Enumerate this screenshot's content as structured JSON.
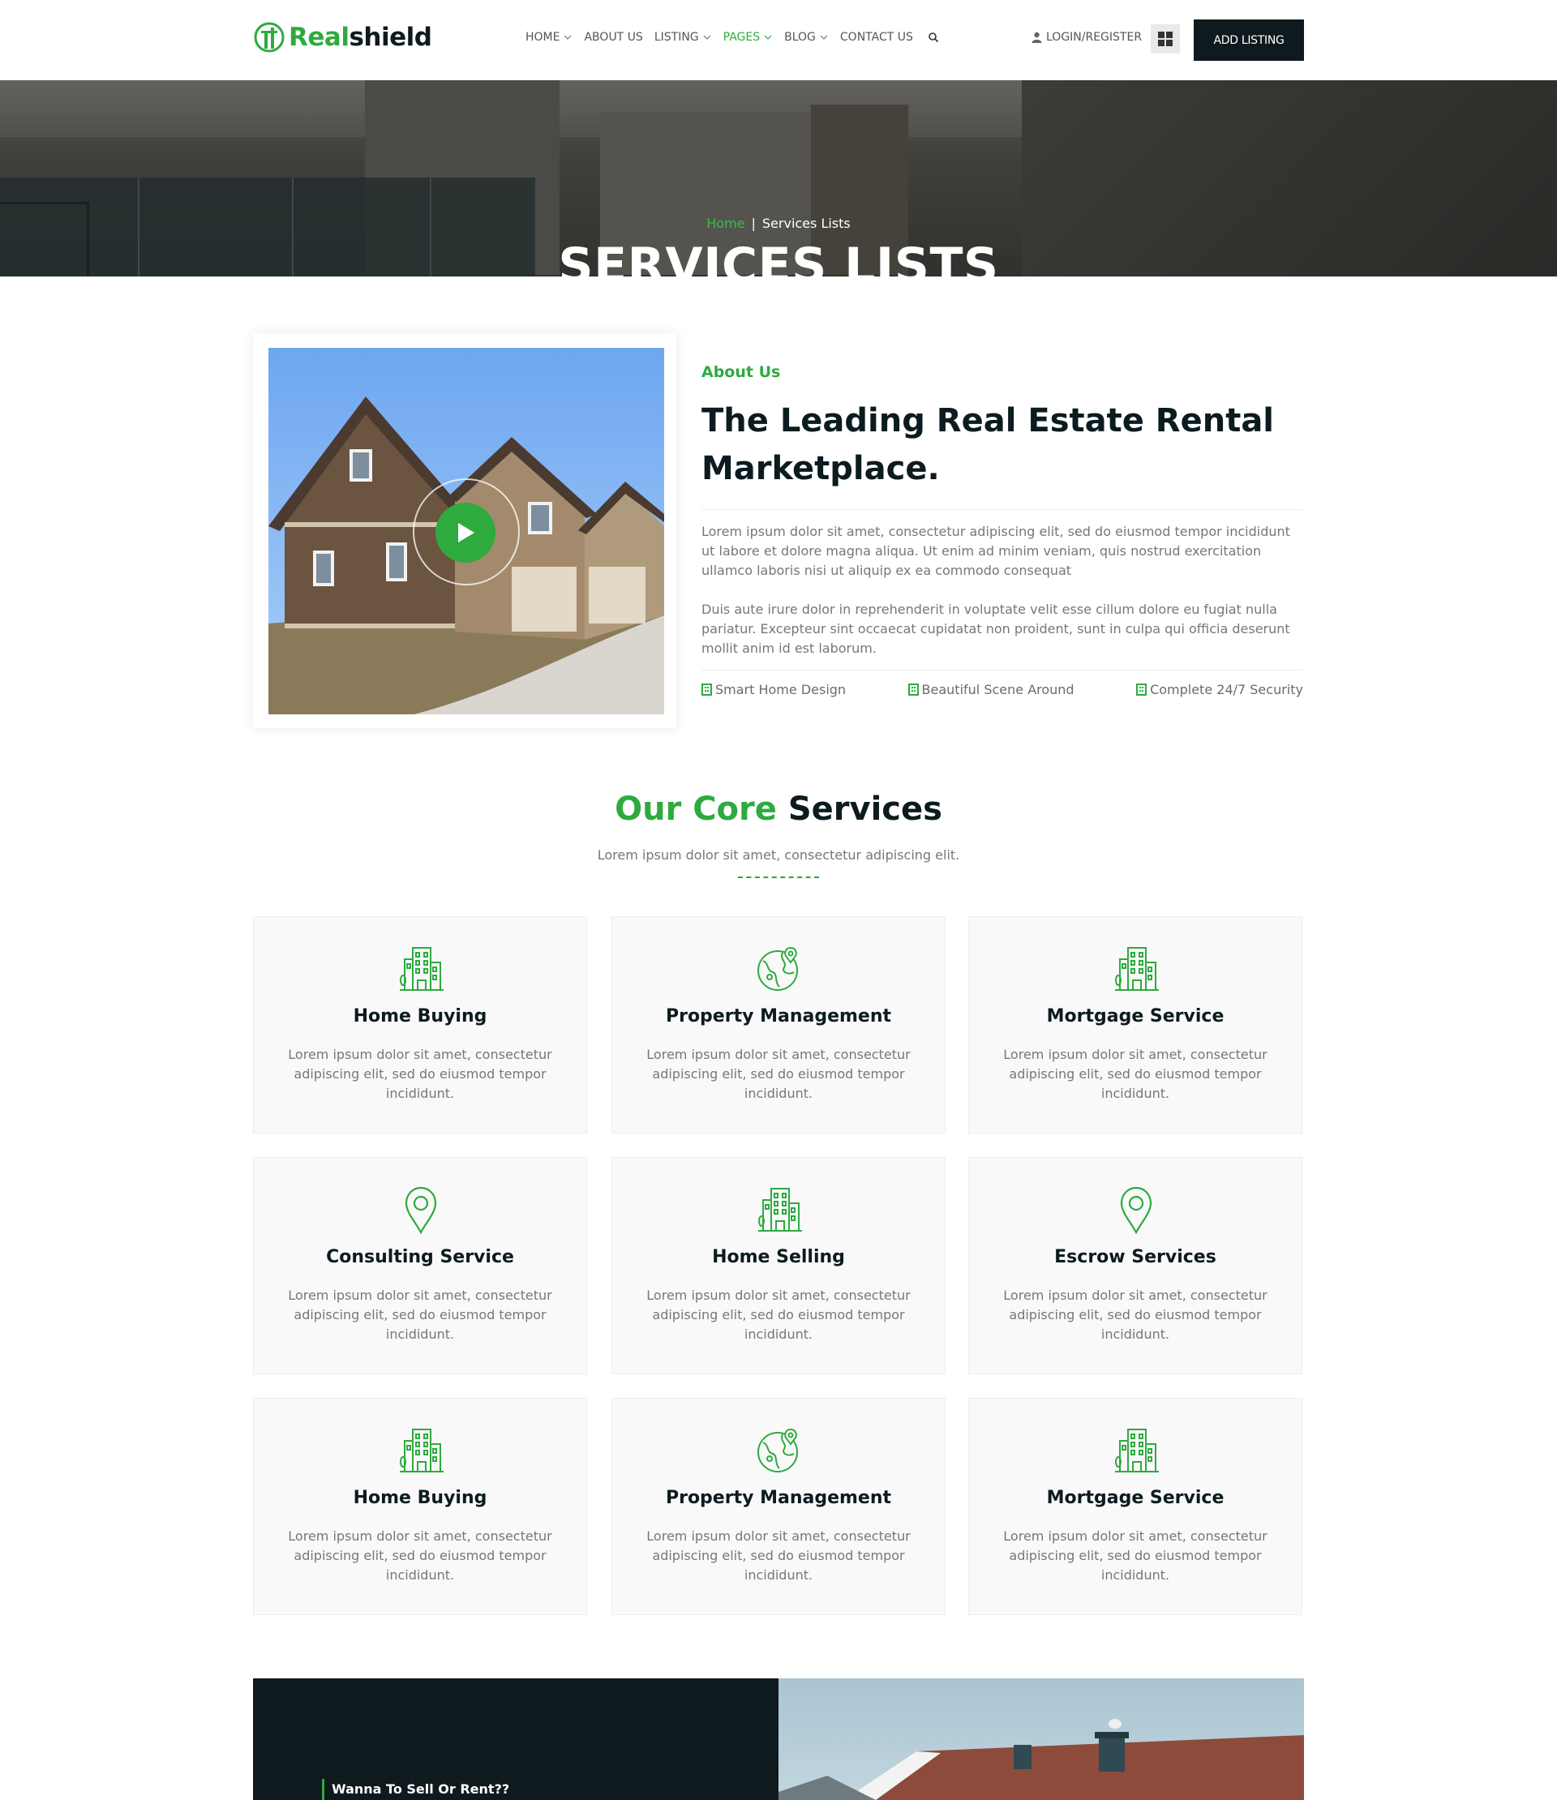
{
  "header": {
    "logo_part1": "Real",
    "logo_part2": "shield",
    "nav": [
      {
        "label": "HOME",
        "dropdown": true,
        "active": false
      },
      {
        "label": "ABOUT US",
        "dropdown": false,
        "active": false
      },
      {
        "label": "LISTING",
        "dropdown": true,
        "active": false
      },
      {
        "label": "PAGES",
        "dropdown": true,
        "active": true
      },
      {
        "label": "BLOG",
        "dropdown": true,
        "active": false
      },
      {
        "label": "CONTACT US",
        "dropdown": false,
        "active": false
      }
    ],
    "search_icon": "search-icon",
    "login_label": "LOGIN/REGISTER",
    "add_listing_label": "ADD LISTING"
  },
  "hero": {
    "breadcrumb_home": "Home",
    "breadcrumb_separator": "|",
    "breadcrumb_current": "Services Lists",
    "title": "SERVICES LISTS"
  },
  "about": {
    "label": "About Us",
    "title": "The Leading Real Estate Rental Marketplace.",
    "paragraph1": "Lorem ipsum dolor sit amet, consectetur adipiscing elit, sed do eiusmod tempor incididunt ut labore et dolore magna aliqua. Ut enim ad minim veniam, quis nostrud exercitation ullamco laboris nisi ut aliquip ex ea commodo consequat",
    "paragraph2": "Duis aute irure dolor in reprehenderit in voluptate velit esse cillum dolore eu fugiat nulla pariatur. Excepteur sint occaecat cupidatat non proident, sunt in culpa qui officia deserunt mollit anim id est laborum.",
    "features": [
      "Smart Home Design",
      "Beautiful Scene Around",
      "Complete 24/7 Security"
    ]
  },
  "core": {
    "title_green": "Our Core",
    "title_dark": "Services",
    "subtitle": "Lorem ipsum dolor sit amet, consectetur adipiscing elit.",
    "cards": [
      {
        "title": "Home Buying",
        "icon": "buildings-icon",
        "desc": "Lorem ipsum dolor sit amet, consectetur adipiscing elit, sed do eiusmod tempor incididunt."
      },
      {
        "title": "Property Management",
        "icon": "globe-pin-icon",
        "desc": "Lorem ipsum dolor sit amet, consectetur adipiscing elit, sed do eiusmod tempor incididunt."
      },
      {
        "title": "Mortgage Service",
        "icon": "buildings-icon",
        "desc": "Lorem ipsum dolor sit amet, consectetur adipiscing elit, sed do eiusmod tempor incididunt."
      },
      {
        "title": "Consulting Service",
        "icon": "map-pin-icon",
        "desc": "Lorem ipsum dolor sit amet, consectetur adipiscing elit, sed do eiusmod tempor incididunt."
      },
      {
        "title": "Home Selling",
        "icon": "buildings-icon",
        "desc": "Lorem ipsum dolor sit amet, consectetur adipiscing elit, sed do eiusmod tempor incididunt."
      },
      {
        "title": "Escrow Services",
        "icon": "map-pin-icon",
        "desc": "Lorem ipsum dolor sit amet, consectetur adipiscing elit, sed do eiusmod tempor incididunt."
      },
      {
        "title": "Home Buying",
        "icon": "buildings-icon",
        "desc": "Lorem ipsum dolor sit amet, consectetur adipiscing elit, sed do eiusmod tempor incididunt."
      },
      {
        "title": "Property Management",
        "icon": "globe-pin-icon",
        "desc": "Lorem ipsum dolor sit amet, consectetur adipiscing elit, sed do eiusmod tempor incididunt."
      },
      {
        "title": "Mortgage Service",
        "icon": "buildings-icon",
        "desc": "Lorem ipsum dolor sit amet, consectetur adipiscing elit, sed do eiusmod tempor incididunt."
      }
    ]
  },
  "cta": {
    "text": "Wanna To Sell Or Rent??"
  },
  "colors": {
    "accent": "#2eaa3f",
    "dark": "#0e1a1d",
    "muted_text": "#777777"
  }
}
